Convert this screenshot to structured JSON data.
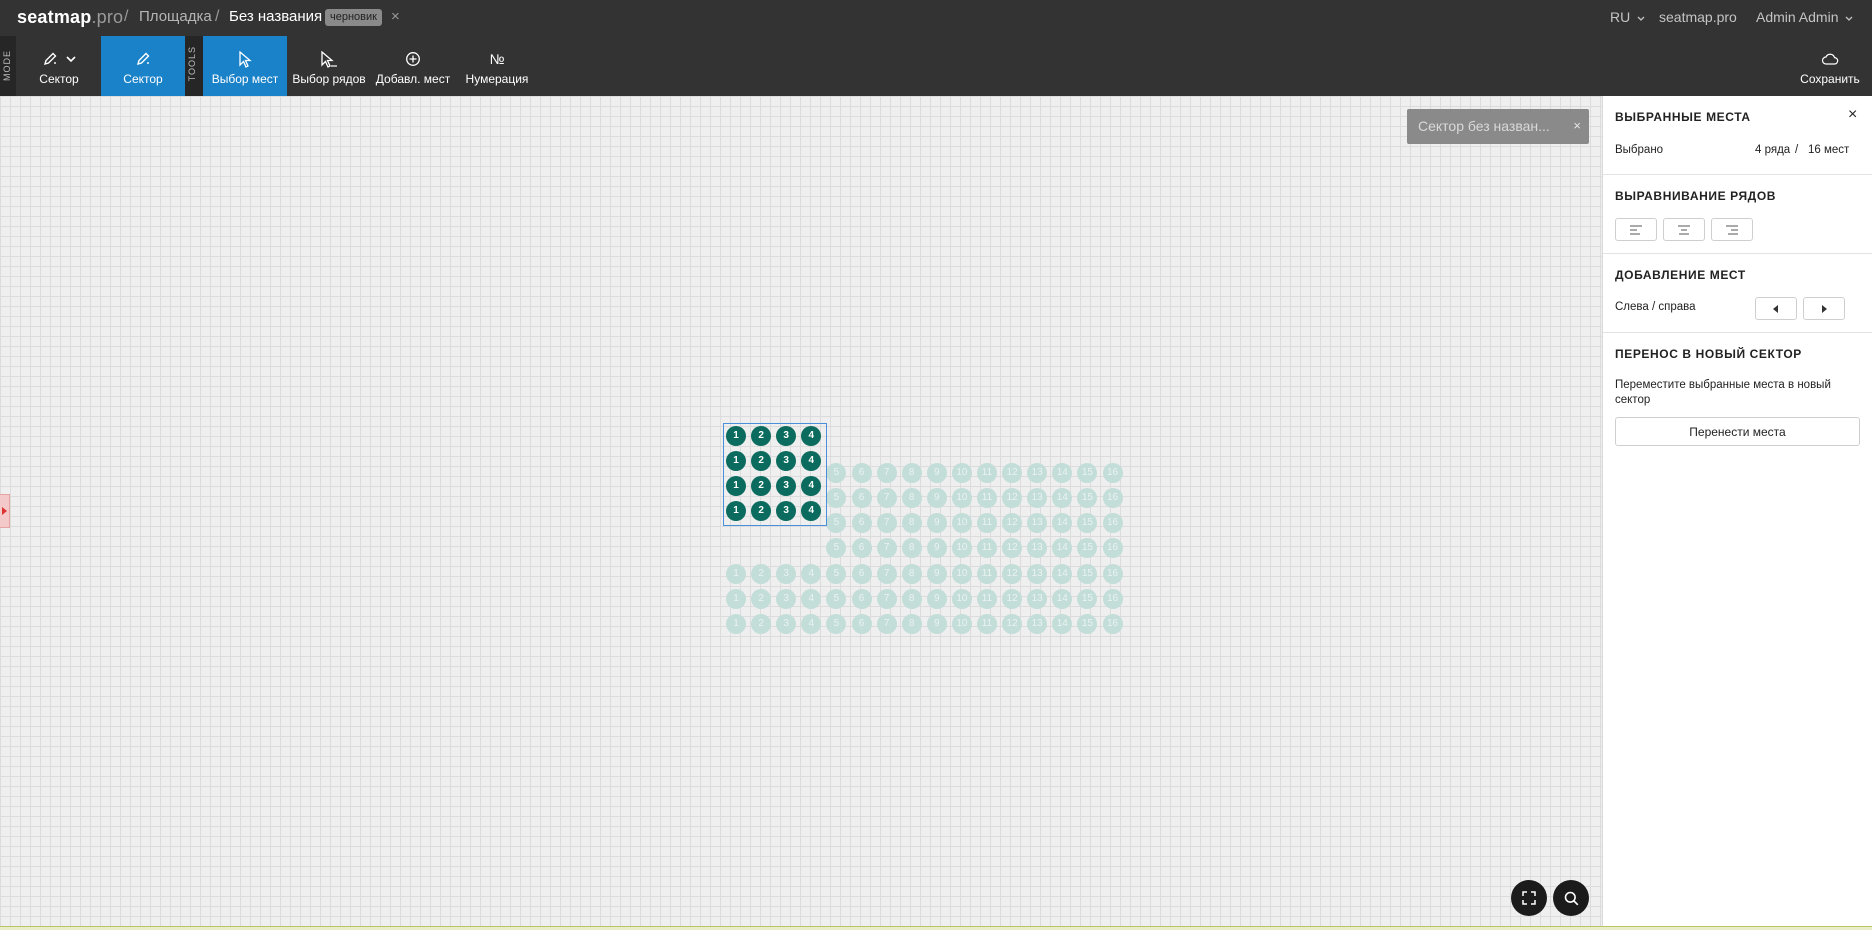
{
  "header": {
    "logo_name": "seatmap",
    "logo_tld": ".pro",
    "breadcrumb": {
      "venue": "Площадка",
      "title": "Без названия",
      "badge": "черновик",
      "close": "×"
    },
    "separator": "/",
    "language": "RU",
    "site_link": "seatmap.pro",
    "user": "Admin Admin"
  },
  "toolbar": {
    "mode_label": "MODE",
    "tools_label": "TOOLS",
    "mode_dropdown": "Сектор",
    "sector_tool": "Сектор",
    "select_seats": "Выбор мест",
    "select_rows": "Выбор рядов",
    "add_seats": "Добавл. мест",
    "numbering": "Нумерация",
    "save": "Сохранить"
  },
  "toast": {
    "text": "Сектор без назван...",
    "close": "×"
  },
  "colors": {
    "accent": "#1a82c8",
    "seat_selected": "#0a6b5e",
    "seat_unselected": "#c3ddd8",
    "header": "#333333"
  },
  "seatmap": {
    "selected_block": {
      "rows": 4,
      "seats": [
        1,
        2,
        3,
        4
      ]
    },
    "upper_rows": {
      "rows": 4,
      "from": 5,
      "to": 16
    },
    "lower_rows": {
      "rows": 3,
      "from": 1,
      "to": 16
    }
  },
  "panel": {
    "selected_title": "ВЫБРАННЫЕ МЕСТА",
    "selected_label": "Выбрано",
    "rows_count": "4 ряда",
    "seats_sep": "/",
    "seats_count": "16 мест",
    "close": "×",
    "align_title": "ВЫРАВНИВАНИЕ РЯДОВ",
    "add_title": "ДОБАВЛЕНИЕ МЕСТ",
    "add_label": "Слева / справа",
    "move_title": "ПЕРЕНОС В НОВЫЙ СЕКТОР",
    "move_text": "Переместите выбранные места в новый сектор",
    "move_button": "Перенести места"
  }
}
